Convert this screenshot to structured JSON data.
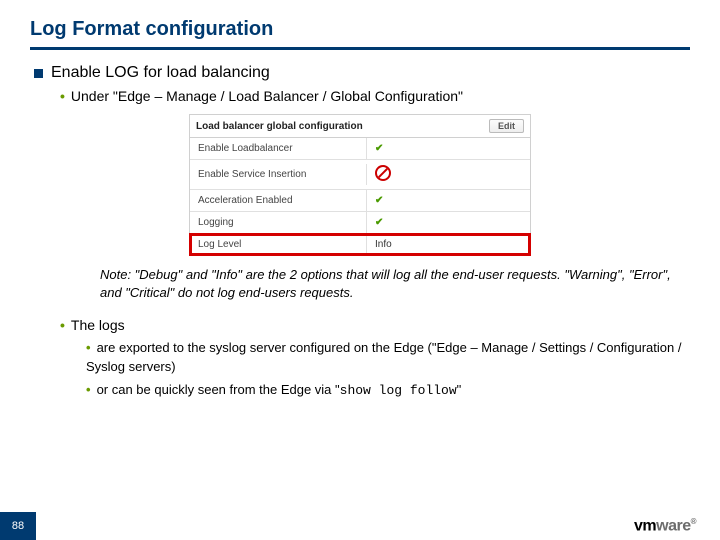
{
  "title": "Log Format configuration",
  "heading": "Enable LOG for load balancing",
  "path_line": "Under \"Edge – Manage /  Load Balancer / Global Configuration\"",
  "config_panel": {
    "header": "Load balancer global configuration",
    "edit_btn": "Edit",
    "rows": [
      {
        "label": "Enable Loadbalancer",
        "state": "check"
      },
      {
        "label": "Enable Service Insertion",
        "state": "no"
      },
      {
        "label": "Acceleration Enabled",
        "state": "check"
      },
      {
        "label": "Logging",
        "state": "check"
      },
      {
        "label": "Log Level",
        "value": "Info",
        "highlight": true
      }
    ]
  },
  "note": "Note: \"Debug\" and \"Info\" are the 2 options that will log all the end-user requests. \"Warning\", \"Error\", and \"Critical\" do not log end-users requests.",
  "logs_intro": "The logs",
  "logs_b1": "are exported to the syslog server configured on the Edge (\"Edge – Manage / Settings / Configuration / Syslog servers)",
  "logs_b2_pre": "or can be quickly seen from the Edge via \"",
  "logs_b2_cmd": "show log follow",
  "logs_b2_post": "\"",
  "page_num": "88",
  "logo_text": "vmware"
}
